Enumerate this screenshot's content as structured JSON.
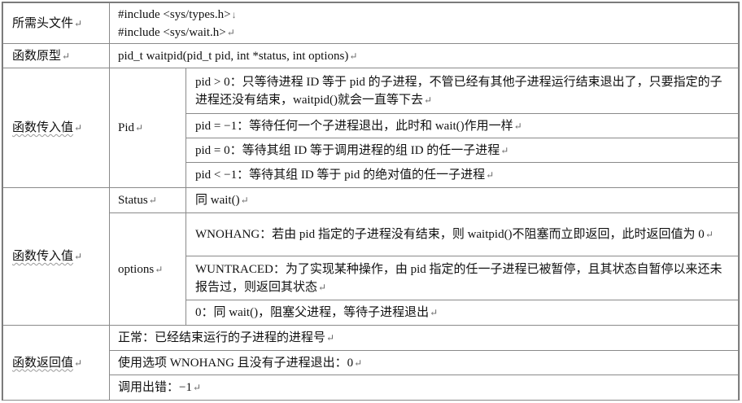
{
  "table": {
    "header_label": "所需头文件",
    "header_lines": [
      "#include <sys/types.h>",
      "#include <sys/wait.h>"
    ],
    "prototype_label": "函数原型",
    "prototype_value": "pid_t waitpid(pid_t pid, int *status, int options)",
    "params1_label": "函数传入值",
    "pid_label": "Pid",
    "pid_rows": [
      "pid > 0：只等待进程 ID 等于 pid 的子进程，不管已经有其他子进程运行结束退出了，只要指定的子进程还没有结束，waitpid()就会一直等下去",
      "pid = −1：等待任何一个子进程退出，此时和 wait()作用一样",
      "pid = 0：等待其组 ID 等于调用进程的组 ID 的任一子进程",
      "pid < −1：等待其组 ID 等于 pid 的绝对值的任一子进程"
    ],
    "params2_label": "函数传入值",
    "status_label": "Status",
    "status_value": "同 wait()",
    "options_label": "options",
    "options_rows": [
      "WNOHANG：若由 pid 指定的子进程没有结束，则 waitpid()不阻塞而立即返回，此时返回值为 0",
      "WUNTRACED：为了实现某种操作，由 pid 指定的任一子进程已被暂停，且其状态自暂停以来还未报告过，则返回其状态",
      "0：同 wait()，阻塞父进程，等待子进程退出"
    ],
    "return_label": "函数返回值",
    "return_rows": [
      "正常：已经结束运行的子进程的进程号",
      "使用选项 WNOHANG 且没有子进程退出：0",
      "调用出错：−1"
    ]
  },
  "colors": {
    "border": "#8a8a8a",
    "text": "#111111",
    "paragraph_mark": "#666666"
  }
}
